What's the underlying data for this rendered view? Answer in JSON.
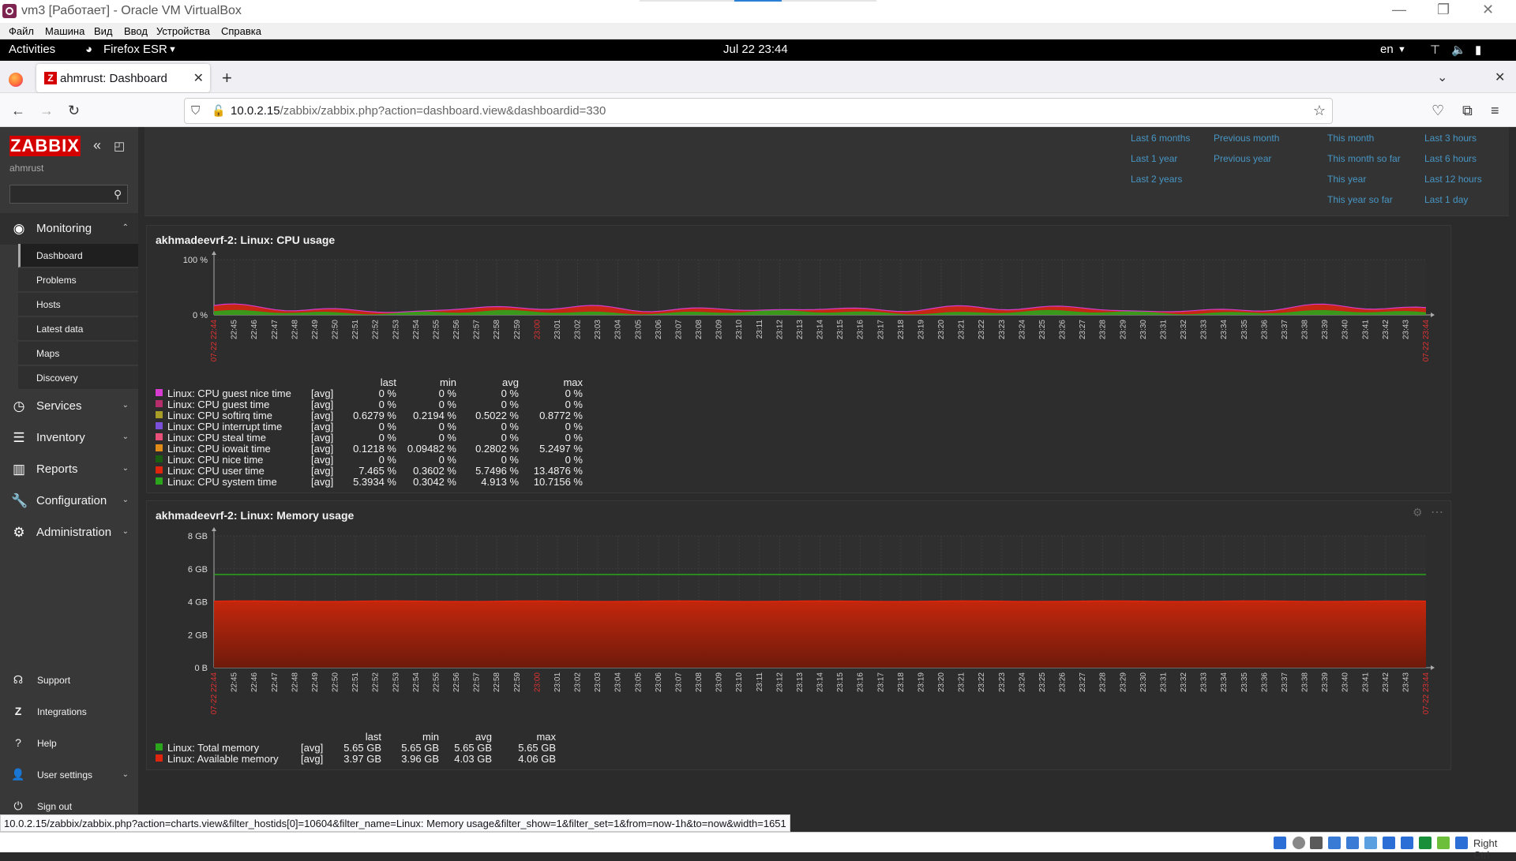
{
  "vbox": {
    "title": "vm3 [Работает] - Oracle VM VirtualBox",
    "menu": [
      "Файл",
      "Машина",
      "Вид",
      "Ввод",
      "Устройства",
      "Справка"
    ],
    "host_key": "Right Ctrl"
  },
  "gnome": {
    "activities": "Activities",
    "app": "Firefox ESR",
    "clock": "Jul 22  23:44",
    "lang": "en"
  },
  "firefox": {
    "tab_title": "ahmrust: Dashboard",
    "url_host": "10.0.2.15",
    "url_path": "/zabbix/zabbix.php?action=dashboard.view&dashboardid=330",
    "status_url": "10.0.2.15/zabbix/zabbix.php?action=charts.view&filter_hostids[0]=10604&filter_name=Linux: Memory usage&filter_show=1&filter_set=1&from=now-1h&to=now&width=1651"
  },
  "sidebar": {
    "logo": "ZABBIX",
    "user": "ahmrust",
    "search_placeholder": "",
    "nav": [
      {
        "label": "Monitoring",
        "icon": "eye-icon"
      },
      {
        "label": "Services",
        "icon": "clock-icon"
      },
      {
        "label": "Inventory",
        "icon": "list-icon"
      },
      {
        "label": "Reports",
        "icon": "bar-chart-icon"
      },
      {
        "label": "Configuration",
        "icon": "wrench-icon"
      },
      {
        "label": "Administration",
        "icon": "gear-icon"
      }
    ],
    "monitoring_sub": [
      "Dashboard",
      "Problems",
      "Hosts",
      "Latest data",
      "Maps",
      "Discovery"
    ],
    "bottom": [
      {
        "label": "Support",
        "icon": "headset-icon"
      },
      {
        "label": "Integrations",
        "icon": "z-icon"
      },
      {
        "label": "Help",
        "icon": "question-icon"
      },
      {
        "label": "User settings",
        "icon": "user-icon"
      },
      {
        "label": "Sign out",
        "icon": "power-icon"
      }
    ]
  },
  "time_presets": {
    "col1": [
      "Last 6 months",
      "Last 1 year",
      "Last 2 years"
    ],
    "col2": [
      "Previous month",
      "Previous year"
    ],
    "col3": [
      "This month",
      "This month so far",
      "This year",
      "This year so far"
    ],
    "col4": [
      "Last 3 hours",
      "Last 6 hours",
      "Last 12 hours",
      "Last 1 day"
    ]
  },
  "chart_data": [
    {
      "type": "area",
      "title": "akhmadeevrf-2: Linux: CPU usage",
      "y_ticks": [
        "100 %",
        "0 %"
      ],
      "ylim": [
        0,
        100
      ],
      "x_start_label": "07-22 22:44",
      "x_end_label": "07-22 23:44",
      "x_ticks": [
        "22:45",
        "22:46",
        "22:47",
        "22:48",
        "22:49",
        "22:50",
        "22:51",
        "22:52",
        "22:53",
        "22:54",
        "22:55",
        "22:56",
        "22:57",
        "22:58",
        "22:59",
        "23:00",
        "23:01",
        "23:02",
        "23:03",
        "23:04",
        "23:05",
        "23:06",
        "23:07",
        "23:08",
        "23:09",
        "23:10",
        "23:11",
        "23:12",
        "23:13",
        "23:14",
        "23:15",
        "23:16",
        "23:17",
        "23:18",
        "23:19",
        "23:20",
        "23:21",
        "23:22",
        "23:23",
        "23:24",
        "23:25",
        "23:26",
        "23:27",
        "23:28",
        "23:29",
        "23:30",
        "23:31",
        "23:32",
        "23:33",
        "23:34",
        "23:35",
        "23:36",
        "23:37",
        "23:38",
        "23:39",
        "23:40",
        "23:41",
        "23:42",
        "23:43"
      ],
      "legend_headers": [
        "last",
        "min",
        "avg",
        "max"
      ],
      "series": [
        {
          "name": "Linux: CPU guest nice time",
          "fn": "[avg]",
          "color": "#d63ccf",
          "last": "0 %",
          "min": "0 %",
          "avg": "0 %",
          "max": "0 %"
        },
        {
          "name": "Linux: CPU guest time",
          "fn": "[avg]",
          "color": "#b62d6c",
          "last": "0 %",
          "min": "0 %",
          "avg": "0 %",
          "max": "0 %"
        },
        {
          "name": "Linux: CPU softirq time",
          "fn": "[avg]",
          "color": "#a89d26",
          "last": "0.6279 %",
          "min": "0.2194 %",
          "avg": "0.5022 %",
          "max": "0.8772 %"
        },
        {
          "name": "Linux: CPU interrupt time",
          "fn": "[avg]",
          "color": "#7b50d9",
          "last": "0 %",
          "min": "0 %",
          "avg": "0 %",
          "max": "0 %"
        },
        {
          "name": "Linux: CPU steal time",
          "fn": "[avg]",
          "color": "#e8507a",
          "last": "0 %",
          "min": "0 %",
          "avg": "0 %",
          "max": "0 %"
        },
        {
          "name": "Linux: CPU iowait time",
          "fn": "[avg]",
          "color": "#e08a18",
          "last": "0.1218 %",
          "min": "0.09482 %",
          "avg": "0.2802 %",
          "max": "5.2497 %"
        },
        {
          "name": "Linux: CPU nice time",
          "fn": "[avg]",
          "color": "#1a5e12",
          "last": "0 %",
          "min": "0 %",
          "avg": "0 %",
          "max": "0 %"
        },
        {
          "name": "Linux: CPU user time",
          "fn": "[avg]",
          "color": "#e0250e",
          "last": "7.465 %",
          "min": "0.3602 %",
          "avg": "5.7496 %",
          "max": "13.4876 %"
        },
        {
          "name": "Linux: CPU system time",
          "fn": "[avg]",
          "color": "#2aa51c",
          "last": "5.3934 %",
          "min": "0.3042 %",
          "avg": "4.913 %",
          "max": "10.7156 %"
        }
      ]
    },
    {
      "type": "area",
      "title": "akhmadeevrf-2: Linux: Memory usage",
      "y_ticks": [
        "8 GB",
        "6 GB",
        "4 GB",
        "2 GB",
        "0 B"
      ],
      "ylim": [
        0,
        8
      ],
      "x_start_label": "07-22 22:44",
      "x_end_label": "07-22 23:44",
      "legend_headers": [
        "last",
        "min",
        "avg",
        "max"
      ],
      "series": [
        {
          "name": "Linux: Total memory",
          "fn": "[avg]",
          "color": "#2aa51c",
          "last": "5.65 GB",
          "min": "5.65 GB",
          "avg": "5.65 GB",
          "max": "5.65 GB",
          "value_gb": 5.65
        },
        {
          "name": "Linux: Available memory",
          "fn": "[avg]",
          "color": "#e0250e",
          "last": "3.97 GB",
          "min": "3.96 GB",
          "avg": "4.03 GB",
          "max": "4.06 GB",
          "value_gb": 4.03
        }
      ]
    }
  ]
}
